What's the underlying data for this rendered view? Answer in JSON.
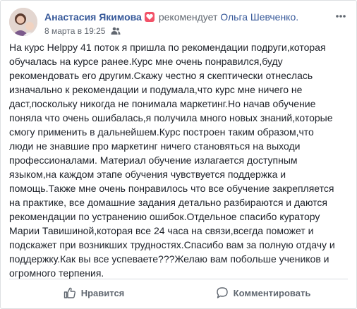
{
  "post": {
    "author": "Анастасия Якимова",
    "recommends_text": "рекомендует",
    "target": "Ольга Шевченко.",
    "timestamp": "8 марта в 19:25",
    "icons": {
      "recommend": "recommend-badge-icon",
      "privacy": "friends-audience-icon",
      "more": "more-options-icon"
    },
    "body": "На курс Helppy 41 поток я пришла по рекомендации подруги,которая обучалась на курсе ранее.Курс мне очень понравился,буду рекомендовать его другим.Скажу честно я скептически отнеслась изначально к рекомендации и подумала,что курс мне ничего не даст,поскольку никогда не понимала маркетинг.Но начав обучение поняла что очень ошибалась,я получила много новых знаний,которые смогу применить в дальнейшем.Курс построен таким образом,что люди не знавшие про маркетинг ничего становяться на выходи профессионалами. Материал обучение излагается доступным языком,на каждом этапе обучения чувствуется поддержка и помощь.Также мне очень понравилось что все обучение закрепляется на практике, все домашние задания детально разбираются и даются рекомендации по устранению ошибок.Отдельное спасибо куратору Марии Тавишиной,которая все 24 часа на связи,всегда поможет и подскажет при возникших трудностях.Спасибо вам за полную отдачу и поддержку.Как вы все успеваете???Желаю вам побольше учеников и огромного терпения."
  },
  "actions": {
    "like_label": "Нравится",
    "comment_label": "Комментировать"
  },
  "colors": {
    "link": "#365899",
    "secondary_text": "#606770",
    "recommend_badge": "#f25268",
    "divider": "#dadde1"
  }
}
